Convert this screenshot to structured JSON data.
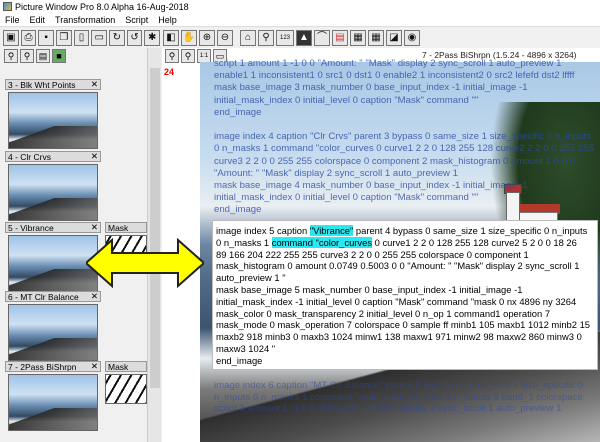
{
  "window": {
    "title": "Picture Window Pro 8.0 Alpha 16-Aug-2018"
  },
  "menu": [
    "File",
    "Edit",
    "Transformation",
    "Script",
    "Help"
  ],
  "toolbar": {
    "left_icons": [
      "new-icon",
      "print-icon",
      "save-icon",
      "copy-icon",
      "clipboard-icon",
      "paste-icon",
      "refresh-icon",
      "undo-icon",
      "settings-icon"
    ],
    "right_icons": [
      "pan-icon",
      "hand-icon",
      "zoom-icon",
      "zoom-icon",
      "mouse-icon",
      "magnify-icon",
      "levels-icon",
      "landscape-icon",
      "hat-icon",
      "channels-icon",
      "histogram-icon",
      "grid-icon",
      "toggle-icon",
      "eye-icon"
    ],
    "levels_label": "123"
  },
  "thumbnails": [
    {
      "title": "3 - Blk Wht Points"
    },
    {
      "title": "4 - Clr Crvs"
    },
    {
      "title": "5 - Vibrance",
      "mask": "Mask"
    },
    {
      "title": "6 - MT Clr Balance"
    },
    {
      "title": "7 - 2Pass BiShrpn",
      "mask": "Mask"
    }
  ],
  "image": {
    "header": "7 - 2Pass BiShrpn (1.5.24 - 4896 x 3264)",
    "zoom_number": "24",
    "top_faded": [
      "script 1 amount 1 -1 0 0 \"Amount: \" \"Mask\" display 2 sync_scroll 1 auto_preview 1",
      "enable1 1 inconsistent1 0 src1 0 dst1 0 enable2 1 inconsistent2 0 src2 lefefd dst2 lffff",
      "mask base_image 3 mask_number 0 base_input_index -1 initial_image -1",
      "initial_mask_index 0 initial_level 0 caption \"Mask\" command \"\"",
      "end_image",
      "",
      "image index 4 caption \"Clr Crvs\" parent 3 bypass 0 same_size 1 size_specific 0 n_inputs",
      "0 n_masks 1 command \"color_curves 0 curve1 2 2 0 128 255 128 curve2 2 2 0 0 255 255",
      "curve3 2 2 0 0 255 255 colorspace 0 component 2 mask_histogram 0 amount 1 0 0 0",
      "\"Amount: \" \"Mask\" display 2 sync_scroll 1 auto_preview 1",
      "mask base_image 4 mask_number 0 base_input_index -1 initial_image -1",
      "initial_mask_index 0 initial_level 0 caption \"Mask\" command \"\"",
      "end_image"
    ],
    "code_lines": [
      {
        "pre": "image index 5 caption ",
        "hl": "\"Vibrance\"",
        "post": " parent 4 bypass 0 same_size 1 size_specific 0 n_inputs"
      },
      {
        "pre": "0 n_masks 1 ",
        "hl": "command \"color_curves",
        "post": " 0 curve1 2 2 0 128 255 128 curve2 5 2 0 0 18 26"
      },
      {
        "pre": "89 166 204 222 255 255 curve3 2 2 0 0 255 255 colorspace 0 component 1",
        "hl": "",
        "post": ""
      },
      {
        "pre": "mask_histogram 0 amount 0.0749 0.5003 0 0 \"Amount: \" \"Mask\" display 2 sync_scroll 1",
        "hl": "",
        "post": ""
      },
      {
        "pre": "auto_preview 1 \"",
        "hl": "",
        "post": ""
      },
      {
        "pre": "   mask base_image 5 mask_number 0 base_input_index -1 initial_image -1",
        "hl": "",
        "post": ""
      },
      {
        "pre": "initial_mask_index -1 initial_level 0 caption \"Mask\" command \"mask 0 nx 4896 ny 3264",
        "hl": "",
        "post": ""
      },
      {
        "pre": "mask_color 0 mask_transparency 2 initial_level 0 n_op 1 command1 operation 7",
        "hl": "",
        "post": ""
      },
      {
        "pre": "mask_mode 0 mask_operation 7 colorspace 0 sample ff minb1 105 maxb1 1012 minb2 15",
        "hl": "",
        "post": ""
      },
      {
        "pre": "maxb2 918 minb3 0 maxb3 1024 minw1 138 maxw1 971 minw2 98 maxw2 860 minw3 0",
        "hl": "",
        "post": ""
      },
      {
        "pre": "maxw3 1024 \"",
        "hl": "",
        "post": ""
      },
      {
        "pre": "end_image",
        "hl": "",
        "post": ""
      }
    ],
    "bottom_faded": [
      "image index 6 caption \"MT Clr Balance\" parent 5 bypass 0 same_size 1 size_specific 0",
      "n_inputs 0 n_masks 1 command \"multi_color_balance 0 n_bands 3 band_1 colorspace",
      "script 1 amount 1 -1 0 0 \"Amount: \" \"Mask\" display 2 sync_scroll 1 auto_preview 1"
    ]
  },
  "colors": {
    "highlight": "#2ae8f0",
    "arrow": "#ffff00",
    "faded_text": "#2b4aa2",
    "zoom_number": "#ee0000"
  }
}
